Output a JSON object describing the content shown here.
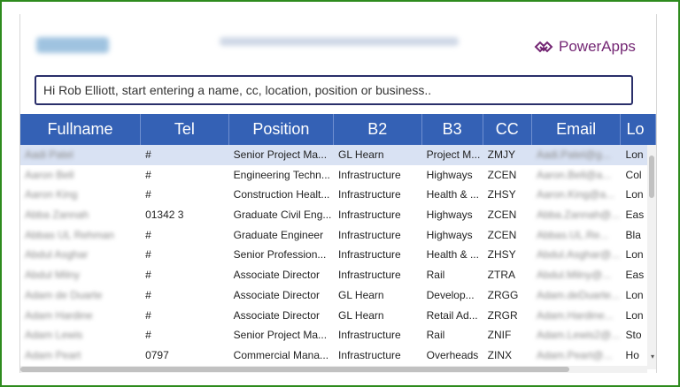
{
  "app": {
    "brand": "PowerApps",
    "colors": {
      "header_bg": "#3461b5",
      "brand": "#742774",
      "selected_row": "#d9e2f3",
      "frame": "#2e8b1e"
    }
  },
  "search": {
    "placeholder": "Hi Rob Elliott, start entering a name, cc, location, position or business.."
  },
  "grid": {
    "columns": [
      "Fullname",
      "Tel",
      "Position",
      "B2",
      "B3",
      "CC",
      "Email",
      "Lo"
    ],
    "rows": [
      [
        "Aadi Patel",
        "#",
        "Senior Project Ma...",
        "GL Hearn",
        "Project M...",
        "ZMJY",
        "Aadi.Patel@g...",
        "Lon"
      ],
      [
        "Aaron Bell",
        "#",
        "Engineering Techn...",
        "Infrastructure",
        "Highways",
        "ZCEN",
        "Aaron.Bell@a...",
        "Col"
      ],
      [
        "Aaron King",
        "#",
        "Construction Healt...",
        "Infrastructure",
        "Health & ...",
        "ZHSY",
        "Aaron.King@a...",
        "Lon"
      ],
      [
        "Abba Zannah",
        "01342 3",
        "Graduate Civil Eng...",
        "Infrastructure",
        "Highways",
        "ZCEN",
        "Abba.Zannah@...",
        "Eas"
      ],
      [
        "Abbas UL Rehman",
        "#",
        "Graduate Engineer",
        "Infrastructure",
        "Highways",
        "ZCEN",
        "Abbas.UL.Re...",
        "Bla"
      ],
      [
        "Abdul Asghar",
        "#",
        "Senior Profession...",
        "Infrastructure",
        "Health & ...",
        "ZHSY",
        "Abdul.Asghar@...",
        "Lon"
      ],
      [
        "Abdul Milny",
        "#",
        "Associate Director",
        "Infrastructure",
        "Rail",
        "ZTRA",
        "Abdul.Milny@...",
        "Eas"
      ],
      [
        "Adam de Duarte",
        "#",
        "Associate Director",
        "GL Hearn",
        "Develop...",
        "ZRGG",
        "Adam.deDuarte...",
        "Lon"
      ],
      [
        "Adam Hardine",
        "#",
        "Associate Director",
        "GL Hearn",
        "Retail Ad...",
        "ZRGR",
        "Adam.Hardine...",
        "Lon"
      ],
      [
        "Adam Lewis",
        "#",
        "Senior Project Ma...",
        "Infrastructure",
        "Rail",
        "ZNIF",
        "Adam.Lewis2@...",
        "Sto"
      ],
      [
        "Adam Peart",
        "0797",
        "Commercial Mana...",
        "Infrastructure",
        "Overheads",
        "ZINX",
        "Adam.Peart@...",
        "Ho"
      ]
    ]
  }
}
